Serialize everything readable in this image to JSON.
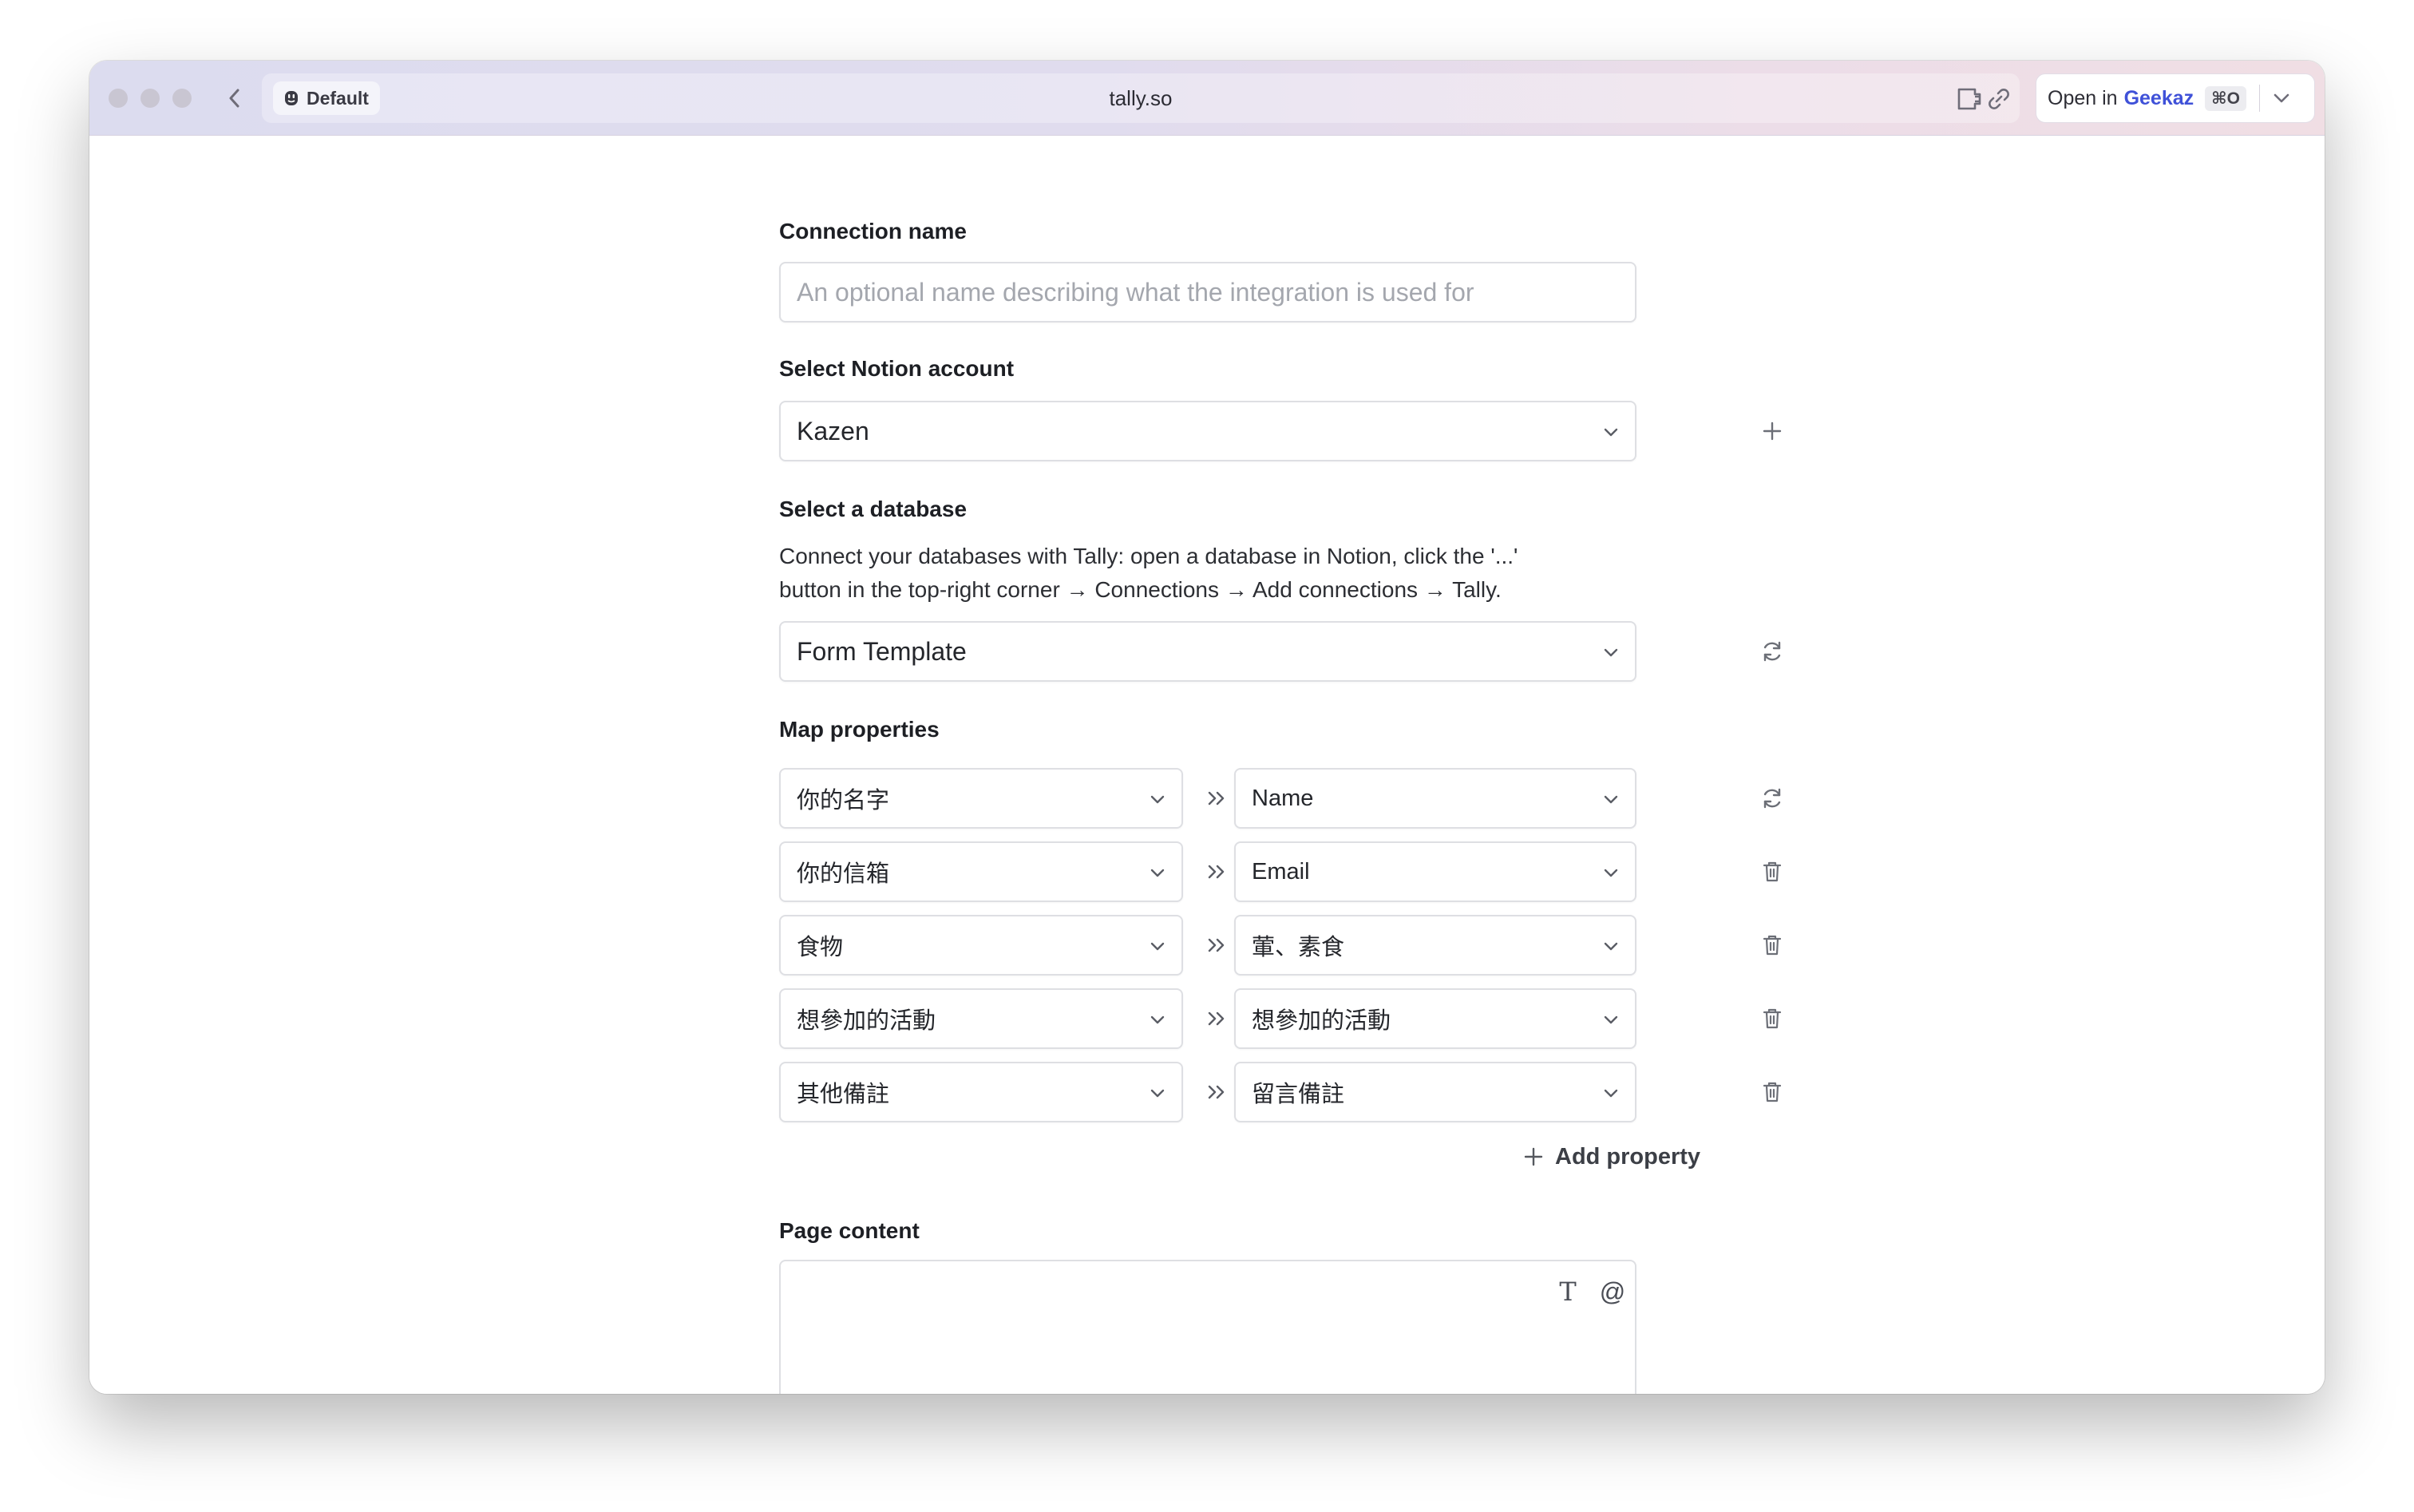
{
  "browser": {
    "profile_label": "Default",
    "url": "tally.so",
    "open_in_prefix": "Open in",
    "open_in_app": "Geekaz",
    "open_in_shortcut": "⌘O"
  },
  "form": {
    "connection_name": {
      "label": "Connection name",
      "value": "",
      "placeholder": "An optional name describing what the integration is used for"
    },
    "notion_account": {
      "label": "Select Notion account",
      "value": "Kazen"
    },
    "database": {
      "label": "Select a database",
      "help_line1": "Connect your databases with Tally: open a database in Notion, click the '...'",
      "help_line2": "button in the top-right corner → Connections → Add connections → Tally.",
      "value": "Form Template"
    },
    "map_properties": {
      "label": "Map properties",
      "rows": [
        {
          "source": "你的名字",
          "target": "Name",
          "action": "refresh-icon"
        },
        {
          "source": "你的信箱",
          "target": "Email",
          "action": "trash-icon"
        },
        {
          "source": "食物",
          "target": "葷、素食",
          "action": "trash-icon"
        },
        {
          "source": "想參加的活動",
          "target": "想參加的活動",
          "action": "trash-icon"
        },
        {
          "source": "其他備註",
          "target": "留言備註",
          "action": "trash-icon"
        }
      ],
      "add_label": "Add property"
    },
    "page_content": {
      "label": "Page content",
      "value": ""
    }
  },
  "icons": {
    "text_format": "T",
    "mention": "@"
  },
  "colors": {
    "accent": "#3f51d8",
    "border": "#dedfe3",
    "placeholder": "#a4a7ae"
  }
}
